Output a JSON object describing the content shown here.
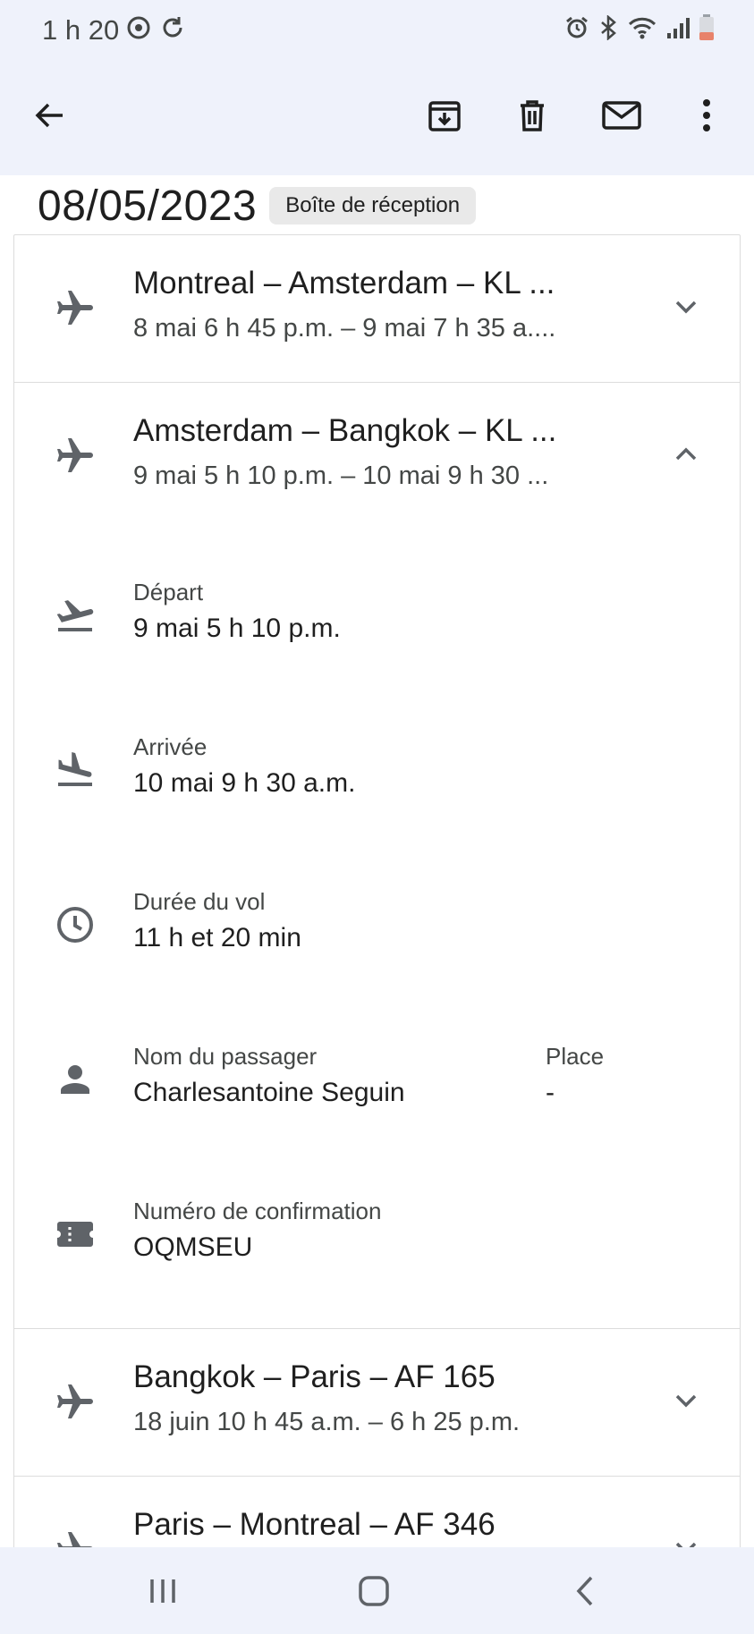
{
  "status_bar": {
    "time": "1 h 20",
    "left_icons": [
      "focus-icon",
      "sync-icon"
    ],
    "right_icons": [
      "alarm-icon",
      "bluetooth-icon",
      "wifi-icon",
      "signal-icon",
      "battery-low-icon"
    ]
  },
  "app_bar": {
    "actions": [
      "back-arrow-icon",
      "archive-icon",
      "delete-icon",
      "mark-unread-icon",
      "more-vert-icon"
    ]
  },
  "email": {
    "date": "08/05/2023",
    "label_chip": "Boîte de réception"
  },
  "flights": [
    {
      "title": "Montreal – Amsterdam – KL ...",
      "subtitle": "8 mai 6 h 45 p.m. – 9 mai 7 h 35 a....",
      "expanded": false
    },
    {
      "title": "Amsterdam – Bangkok – KL ...",
      "subtitle": "9 mai 5 h 10 p.m. – 10 mai 9 h 30 ...",
      "expanded": true,
      "details": {
        "departure_label": "Départ",
        "departure_value": "9 mai 5 h 10 p.m.",
        "arrival_label": "Arrivée",
        "arrival_value": "10 mai 9 h 30 a.m.",
        "duration_label": "Durée du vol",
        "duration_value": "11 h et 20 min",
        "passenger_label": "Nom du passager",
        "passenger_value": "Charlesantoine Seguin",
        "seat_label": "Place",
        "seat_value": "-",
        "confirmation_label": "Numéro de confirmation",
        "confirmation_value": "OQMSEU"
      }
    },
    {
      "title": "Bangkok – Paris – AF 165",
      "subtitle": "18 juin 10 h 45 a.m. – 6 h 25 p.m.",
      "expanded": false
    },
    {
      "title": "Paris – Montreal – AF 346",
      "subtitle": "",
      "expanded": false
    }
  ],
  "colors": {
    "chrome_background": "#eff2fb",
    "icon_grey": "#5f6368",
    "text_primary": "#1f1f1f",
    "text_secondary": "#444746",
    "battery_low": "#e8826a"
  }
}
